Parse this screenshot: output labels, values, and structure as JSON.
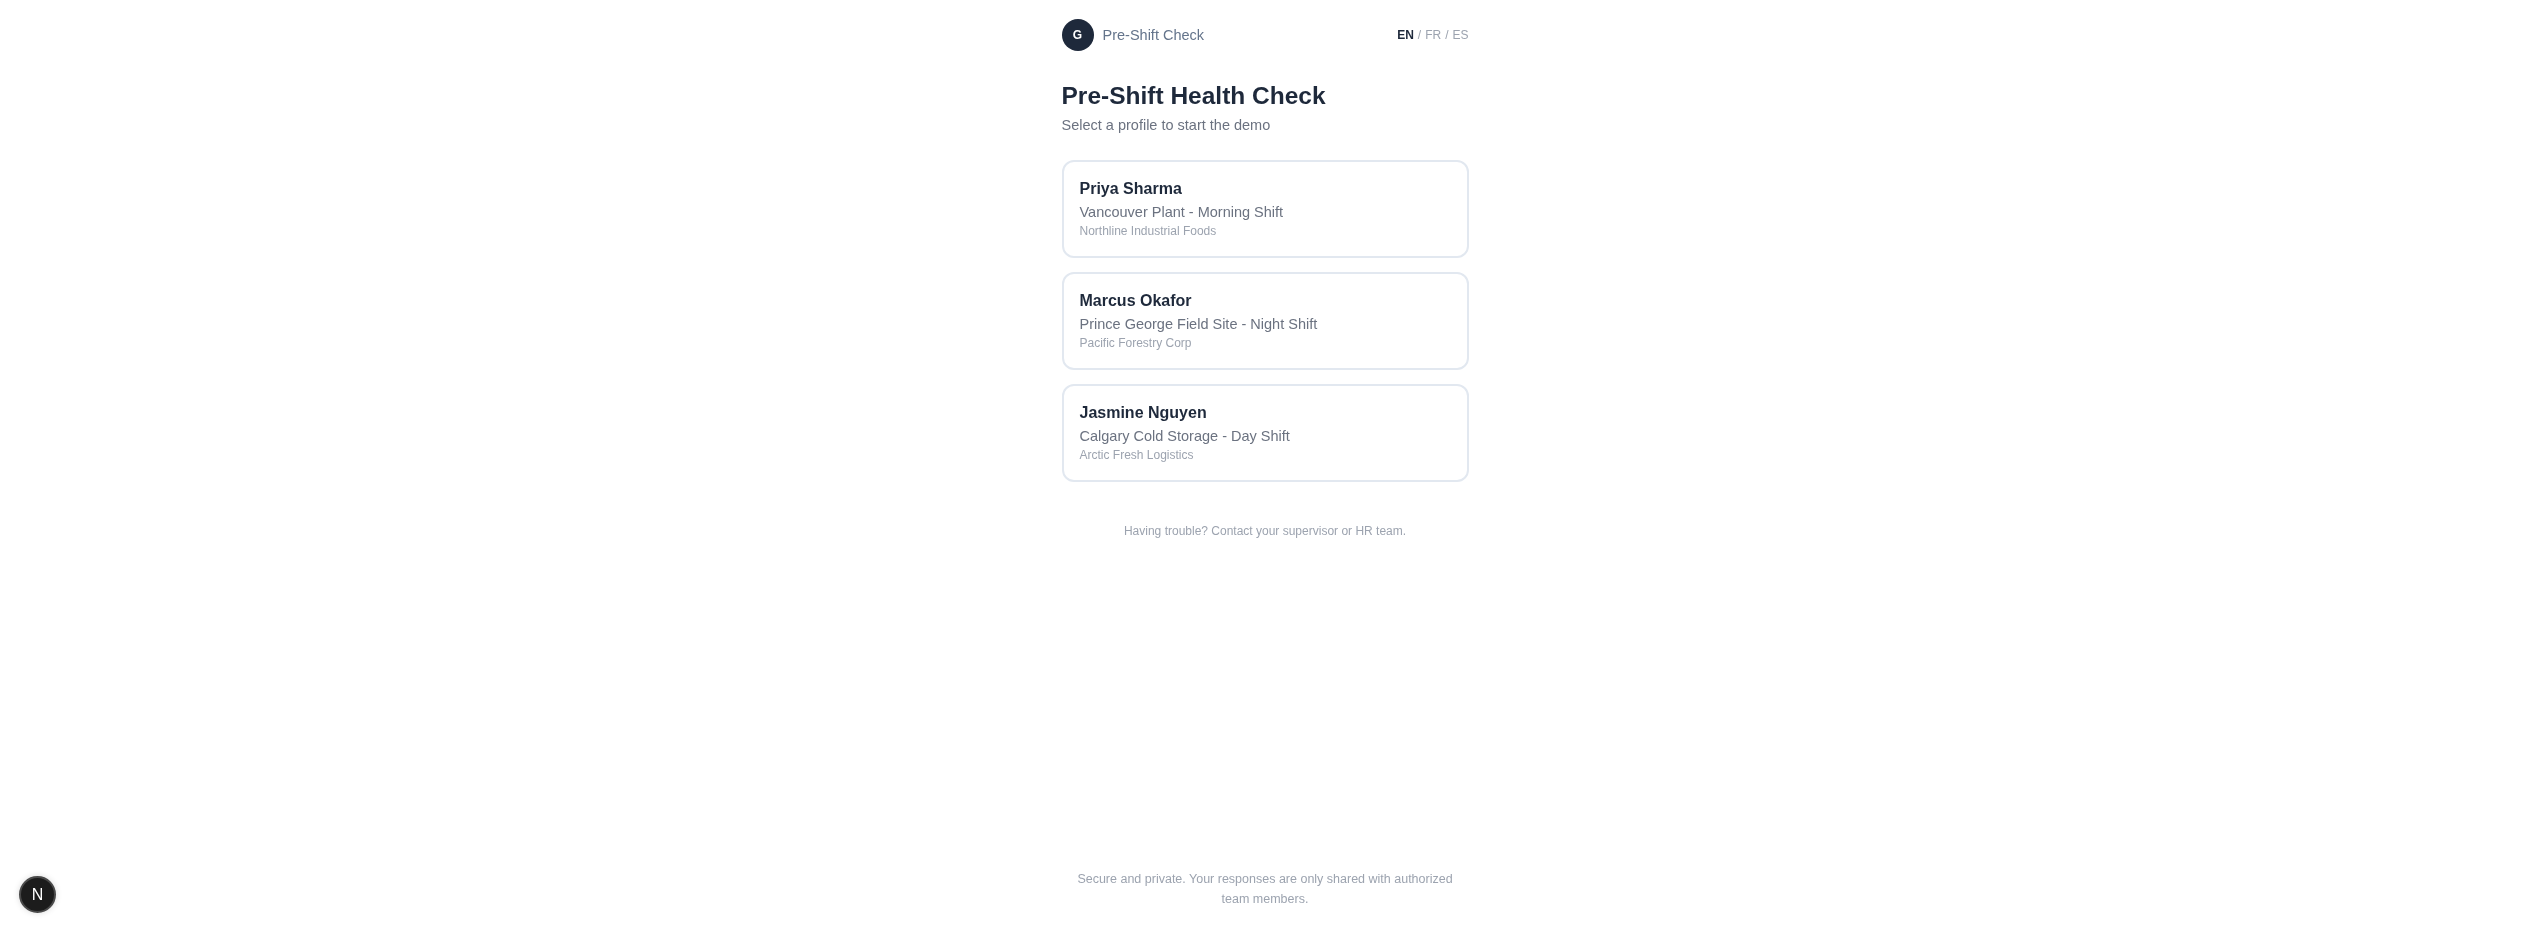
{
  "header": {
    "avatar_initial": "G",
    "app_name": "Pre-Shift Check",
    "languages": [
      {
        "label": "EN",
        "selected": true
      },
      {
        "separator": "/",
        "label": "FR",
        "selected": false
      },
      {
        "separator": "/",
        "label": "ES",
        "selected": false
      }
    ]
  },
  "title": "Pre-Shift Health Check",
  "subtitle": "Select a profile to start the demo",
  "profiles": [
    {
      "name": "Priya Sharma",
      "location": "Vancouver Plant - Morning Shift",
      "company": "Northline Industrial Foods"
    },
    {
      "name": "Marcus Okafor",
      "location": "Prince George Field Site - Night Shift",
      "company": "Pacific Forestry Corp"
    },
    {
      "name": "Jasmine Nguyen",
      "location": "Calgary Cold Storage - Day Shift",
      "company": "Arctic Fresh Logistics"
    }
  ],
  "help_text": "Having trouble? Contact your supervisor or HR team.",
  "footer": "Secure and private. Your responses are only shared with authorized team members.",
  "dev_badge": {
    "label": "N"
  }
}
